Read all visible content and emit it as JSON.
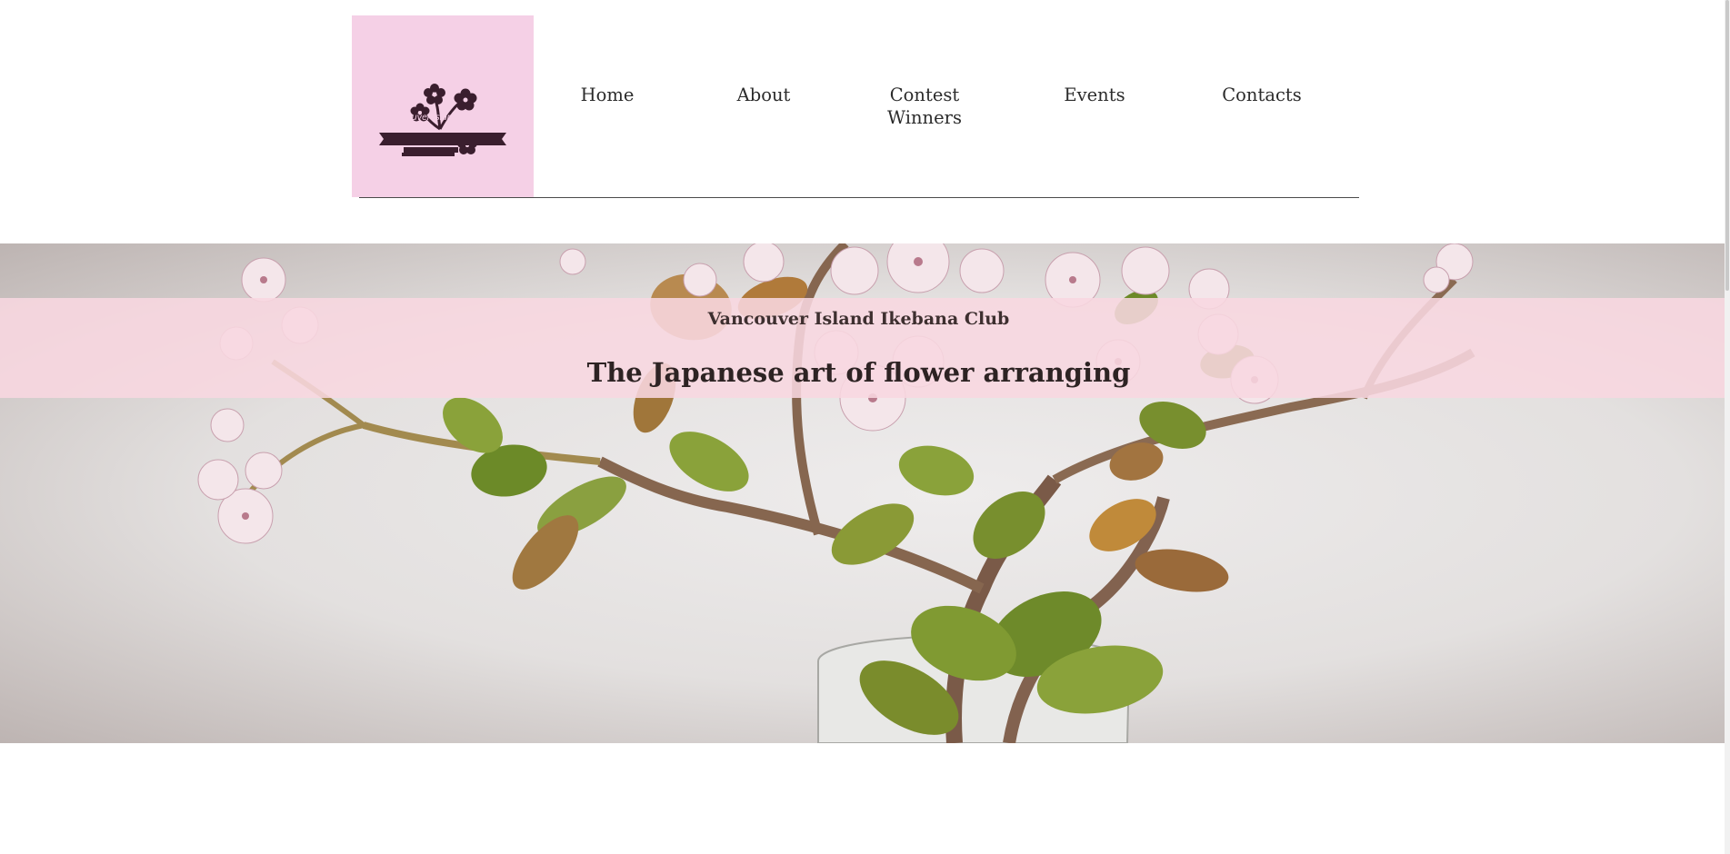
{
  "logo": {
    "text": "Vancouver Island Ikebana Club",
    "icon": "ikebana-flower-logo-icon",
    "background": "#f5d0e6",
    "ink": "#3a1e2e"
  },
  "nav": {
    "items": [
      {
        "label": "Home"
      },
      {
        "label": "About"
      },
      {
        "label": "Contest Winners"
      },
      {
        "label": "Events"
      },
      {
        "label": "Contacts"
      }
    ]
  },
  "hero": {
    "club_name": "Vancouver Island Ikebana Club",
    "tagline": "The Japanese art of flower arranging",
    "band_color": "#f8d7e0",
    "image": "jade-plant-ikebana-arrangement"
  }
}
